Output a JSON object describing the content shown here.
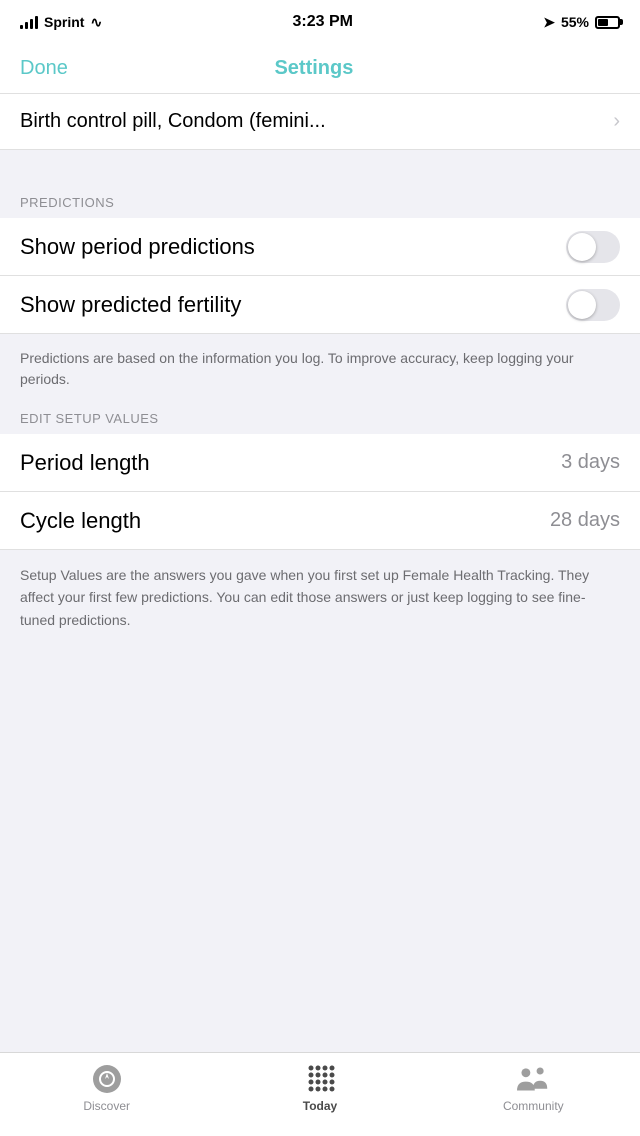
{
  "statusBar": {
    "carrier": "Sprint",
    "time": "3:23 PM",
    "battery": "55%"
  },
  "header": {
    "done_label": "Done",
    "title": "Settings"
  },
  "birthControl": {
    "label": "Birth control pill, Condom (femini...",
    "chevron": "›"
  },
  "predictions": {
    "section_header": "PREDICTIONS",
    "show_period_label": "Show period predictions",
    "show_fertility_label": "Show predicted fertility",
    "info_text": "Predictions are based on the information you log. To improve accuracy, keep logging your periods."
  },
  "editSetupValues": {
    "section_header": "EDIT SETUP VALUES",
    "period_length_label": "Period length",
    "period_length_value": "3 days",
    "cycle_length_label": "Cycle length",
    "cycle_length_value": "28 days",
    "info_text": "Setup Values are the answers you gave when you first set up Female Health Tracking. They affect your first few predictions. You can edit those answers or just keep logging to see fine-tuned predictions."
  },
  "tabBar": {
    "discover_label": "Discover",
    "today_label": "Today",
    "community_label": "Community"
  }
}
